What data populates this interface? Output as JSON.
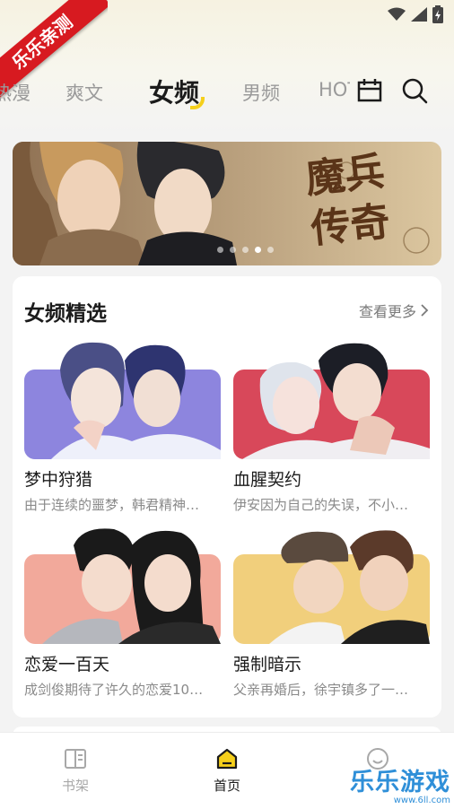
{
  "ribbon_label": "乐乐亲测",
  "tabs": [
    {
      "label": "热漫"
    },
    {
      "label": "爽文"
    },
    {
      "label": "女频"
    },
    {
      "label": "男频"
    },
    {
      "label": "HOT"
    }
  ],
  "banner": {
    "title": "魔兵传奇",
    "dots_total": 5,
    "active_dot": 4
  },
  "section": {
    "title": "女频精选",
    "more_label": "查看更多",
    "items": [
      {
        "title": "梦中狩猎",
        "desc": "由于连续的噩梦，韩君精神…"
      },
      {
        "title": "血腥契约",
        "desc": "伊安因为自己的失误，不小…"
      },
      {
        "title": "恋爱一百天",
        "desc": "成剑俊期待了许久的恋爱10…"
      },
      {
        "title": "强制暗示",
        "desc": "父亲再婚后，徐宇镇多了一…"
      }
    ]
  },
  "bottom_nav": [
    {
      "label": "书架",
      "icon": "book-icon"
    },
    {
      "label": "首页",
      "icon": "home-icon"
    },
    {
      "label": "",
      "icon": "smile-icon"
    }
  ],
  "watermark": {
    "main": "乐乐游戏",
    "sub": "www.6ll.com"
  },
  "colors": {
    "accent": "#f5cf1b",
    "ribbon": "#d71a20",
    "watermark": "#2f8fd8"
  }
}
